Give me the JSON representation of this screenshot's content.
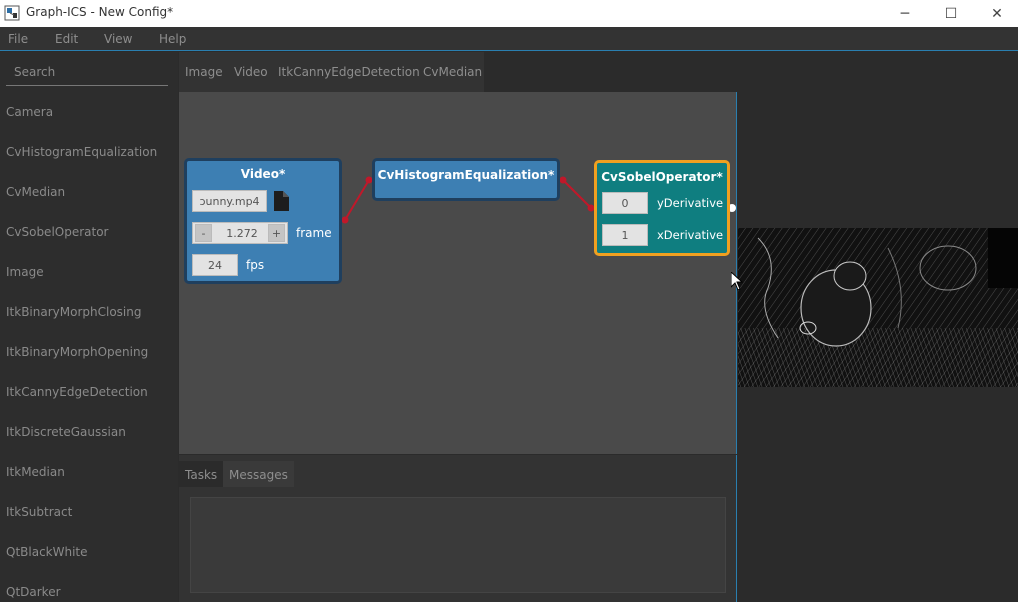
{
  "window": {
    "title": "Graph-ICS - New Config*",
    "minimize_glyph": "─",
    "maximize_glyph": "☐",
    "close_glyph": "✕"
  },
  "menu": [
    "File",
    "Edit",
    "View",
    "Help"
  ],
  "sidebar": {
    "search_placeholder": "Search",
    "components": [
      "Camera",
      "CvHistogramEqualization",
      "CvMedian",
      "CvSobelOperator",
      "Image",
      "ItkBinaryMorphClosing",
      "ItkBinaryMorphOpening",
      "ItkCannyEdgeDetection",
      "ItkDiscreteGaussian",
      "ItkMedian",
      "ItkSubtract",
      "QtBlackWhite",
      "QtDarker"
    ]
  },
  "tabs": [
    "Image",
    "Video",
    "ItkCannyEdgeDetection",
    "CvMedian"
  ],
  "nodes": {
    "video": {
      "title": "Video*",
      "file_value": "ɔunny.mp4",
      "frame_decrement": "-",
      "frame_value": "1.272",
      "frame_increment": "+",
      "frame_label": "frame",
      "fps_value": "24",
      "fps_label": "fps",
      "color": "#3d7fb3"
    },
    "histogram": {
      "title": "CvHistogramEqualization*",
      "color": "#3d7fb3"
    },
    "sobel": {
      "title": "CvSobelOperator*",
      "y_value": "0",
      "y_label": "yDerivative",
      "x_value": "1",
      "x_label": "xDerivative",
      "color": "#0f7e80",
      "border_color": "#f0a020"
    }
  },
  "bottom": {
    "tabs": [
      "Tasks",
      "Messages"
    ]
  },
  "colors": {
    "accent": "#2a7fb0",
    "edge": "#c0182a"
  }
}
